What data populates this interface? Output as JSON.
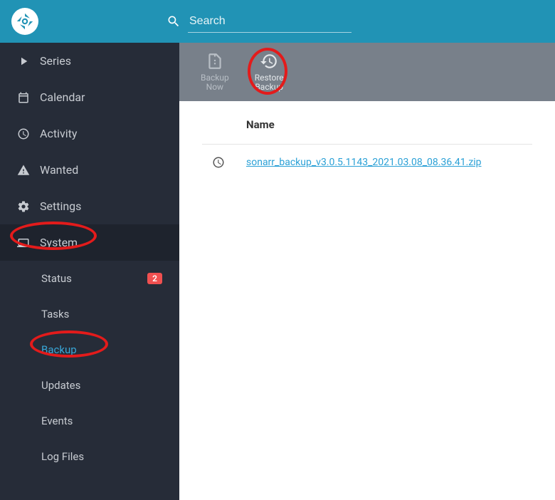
{
  "search": {
    "placeholder": "Search"
  },
  "sidebar": {
    "items": [
      {
        "label": "Series"
      },
      {
        "label": "Calendar"
      },
      {
        "label": "Activity"
      },
      {
        "label": "Wanted"
      },
      {
        "label": "Settings"
      },
      {
        "label": "System"
      }
    ],
    "sub": [
      {
        "label": "Status",
        "badge": "2"
      },
      {
        "label": "Tasks"
      },
      {
        "label": "Backup"
      },
      {
        "label": "Updates"
      },
      {
        "label": "Events"
      },
      {
        "label": "Log Files"
      }
    ]
  },
  "toolbar": {
    "backup_now": {
      "line1": "Backup",
      "line2": "Now"
    },
    "restore_backup": {
      "line1": "Restore",
      "line2": "Backup"
    }
  },
  "table": {
    "header_name": "Name",
    "rows": [
      {
        "name": "sonarr_backup_v3.0.5.1143_2021.03.08_08.36.41.zip"
      }
    ]
  }
}
